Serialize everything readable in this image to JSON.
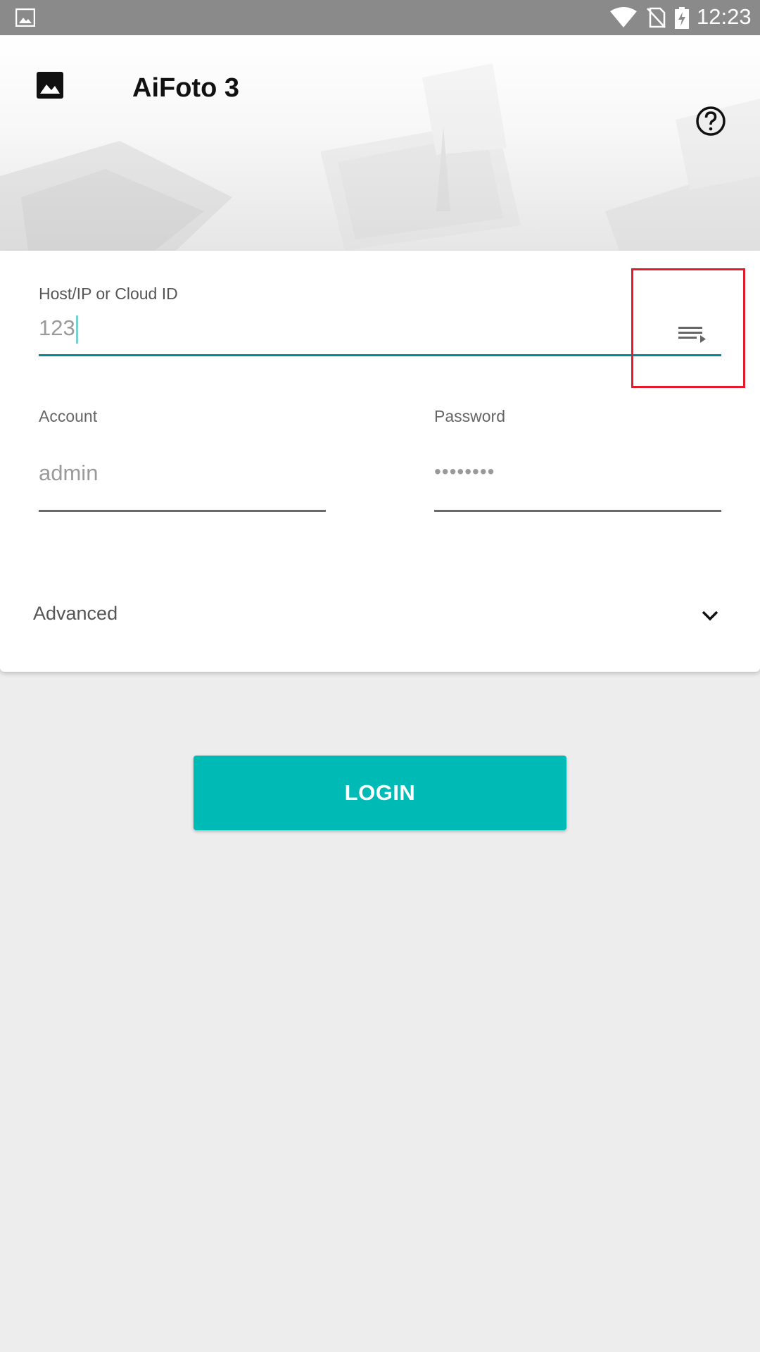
{
  "status_bar": {
    "time": "12:23",
    "icons": [
      "image-notification-icon",
      "wifi-icon",
      "no-sim-icon",
      "battery-charging-icon"
    ]
  },
  "header": {
    "app_title": "AiFoto 3",
    "app_icon": "image-icon",
    "help_icon": "help-circle-icon"
  },
  "form": {
    "host": {
      "label": "Host/IP or Cloud ID",
      "value": "123",
      "history_icon": "history-list-icon"
    },
    "account": {
      "label": "Account",
      "value": "admin"
    },
    "password": {
      "label": "Password",
      "value": "••••••••"
    },
    "advanced": {
      "label": "Advanced",
      "icon": "chevron-down-icon"
    }
  },
  "login_button": {
    "label": "LOGIN"
  },
  "colors": {
    "accent": "#00bbb5",
    "active_underline": "#00899a",
    "highlight": "#e21a2a",
    "status_bar": "#8a8a8a"
  }
}
